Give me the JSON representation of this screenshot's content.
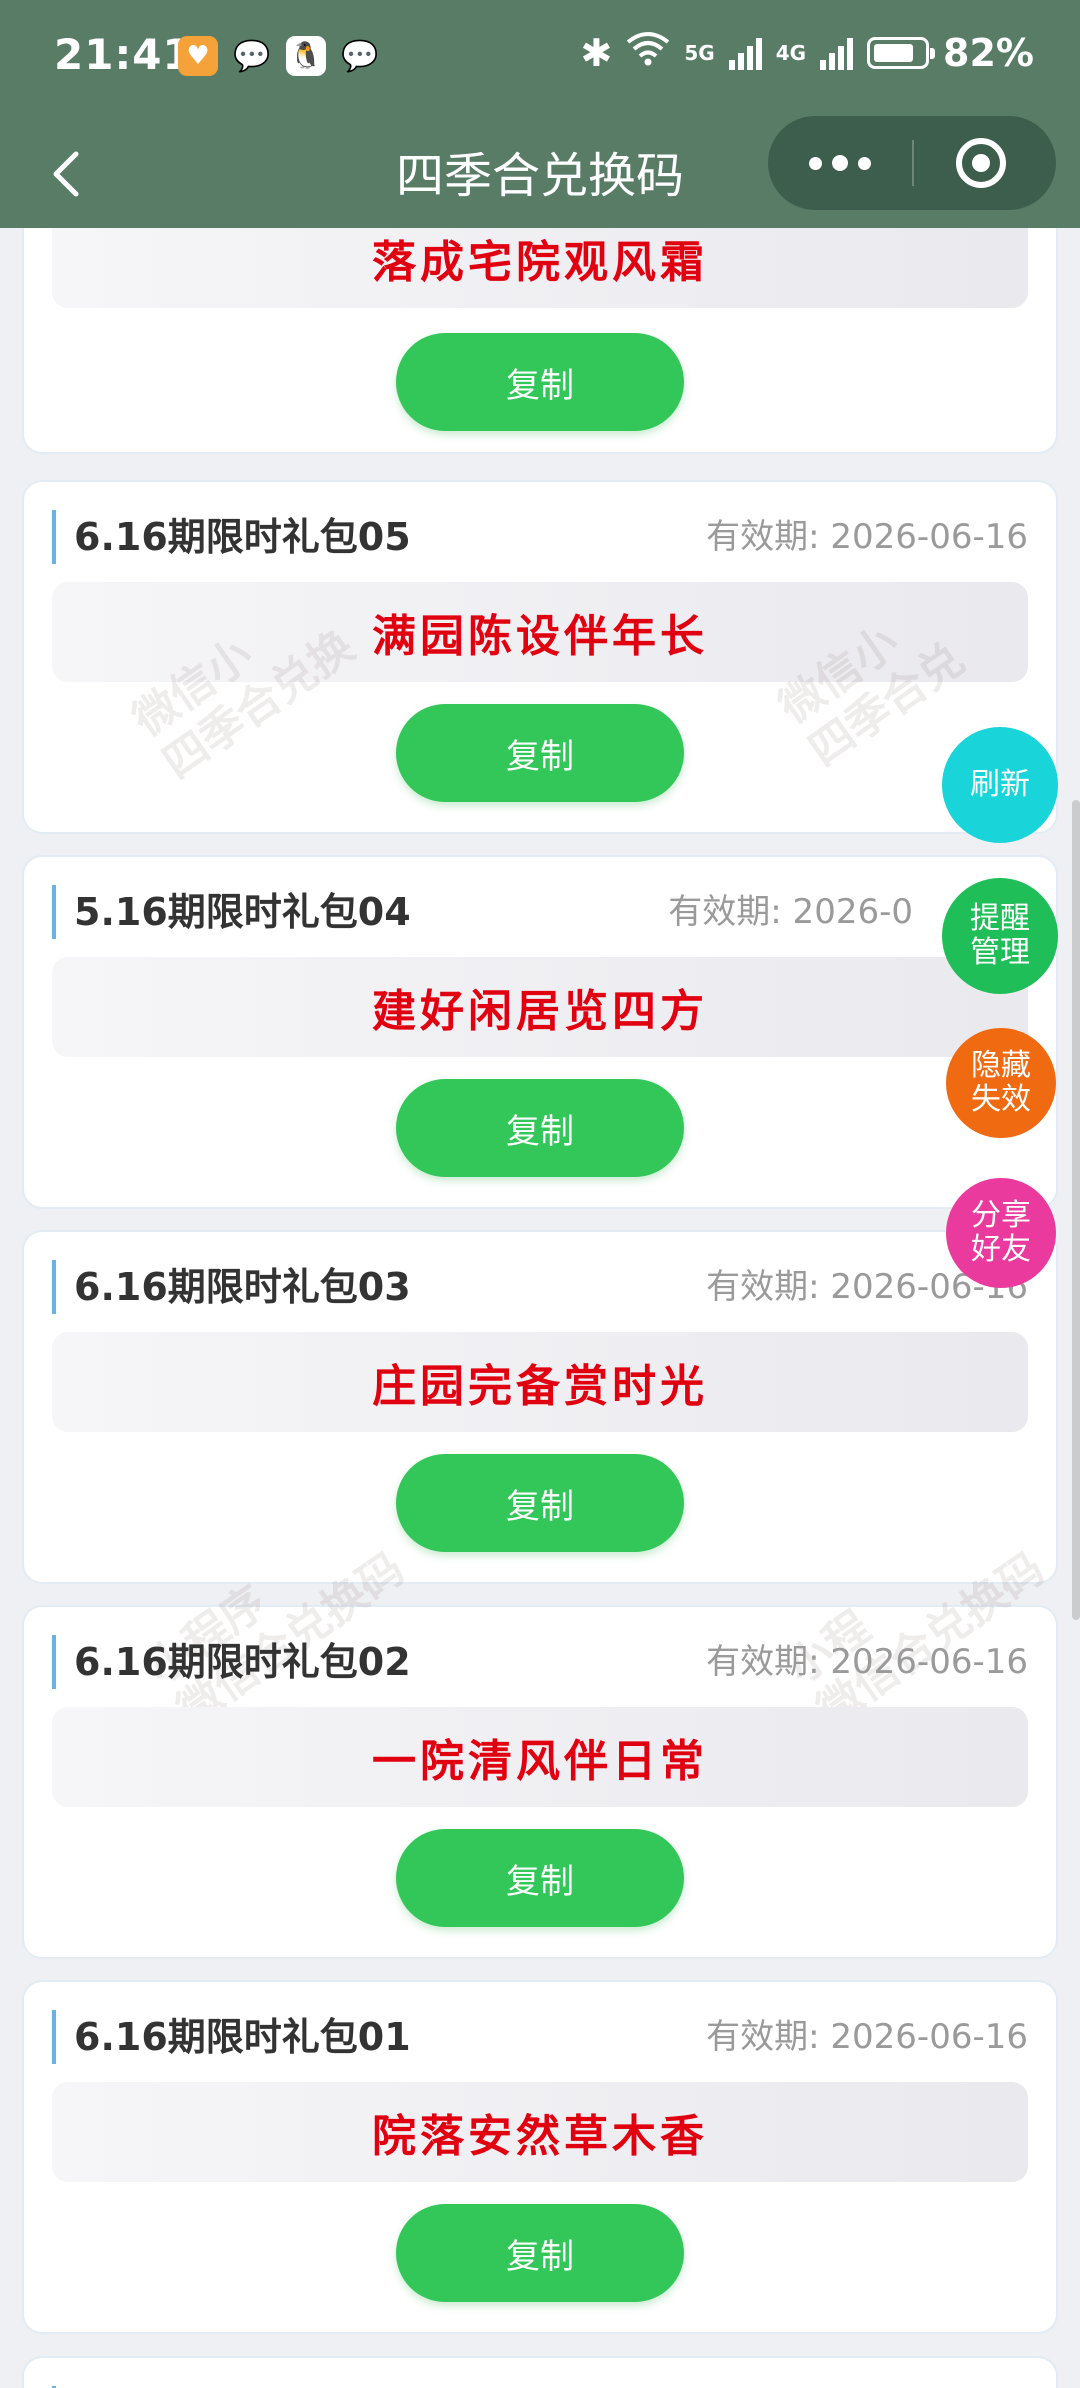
{
  "status": {
    "time": "21:41",
    "net1": "5G",
    "net2": "4G",
    "battery": "82%",
    "battery_level": 0.82
  },
  "nav": {
    "title": "四季合兑换码"
  },
  "partial_card": {
    "code": "落成宅院观风霜",
    "copy_label": "复制"
  },
  "cards": [
    {
      "name": "6.16期限时礼包05",
      "expiry": "有效期: 2026-06-16",
      "code": "满园陈设伴年长",
      "copy_label": "复制"
    },
    {
      "name": "5.16期限时礼包04",
      "expiry": "有效期: 2026-0",
      "code": "建好闲居览四方",
      "copy_label": "复制"
    },
    {
      "name": "6.16期限时礼包03",
      "expiry": "有效期: 2026-06-16",
      "code": "庄园完备赏时光",
      "copy_label": "复制"
    },
    {
      "name": "6.16期限时礼包02",
      "expiry": "有效期: 2026-06-16",
      "code": "一院清风伴日常",
      "copy_label": "复制"
    },
    {
      "name": "6.16期限时礼包01",
      "expiry": "有效期: 2026-06-16",
      "code": "院落安然草木香",
      "copy_label": "复制"
    }
  ],
  "floating": {
    "refresh": "刷新",
    "reminder": "提醒\n管理",
    "hide": "隐藏\n失效",
    "share": "分享\n好友"
  },
  "colors": {
    "header_bg": "#587c66",
    "code_red": "#e10010",
    "copy_green": "#33c75a",
    "refresh": "#19d4d8",
    "reminder": "#1fbe58",
    "hide": "#f06a12",
    "share": "#ea3a9e"
  }
}
